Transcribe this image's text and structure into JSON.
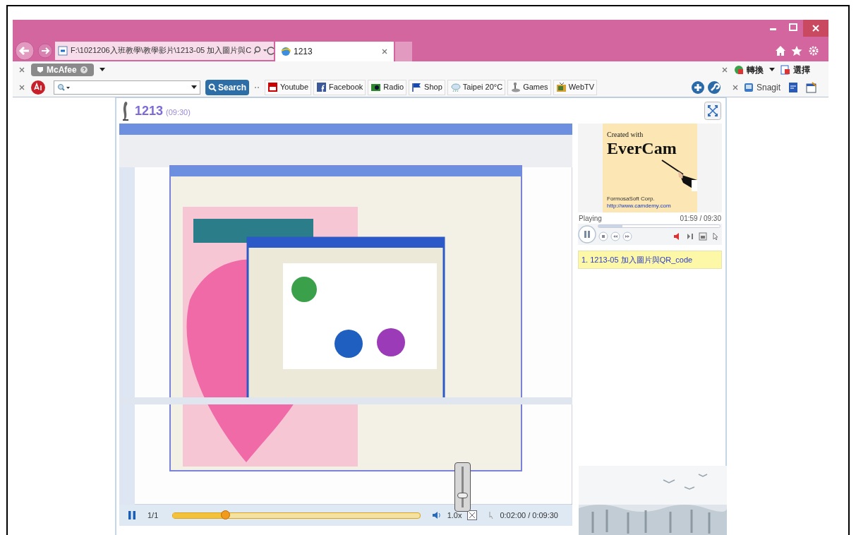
{
  "browser": {
    "address": "F:\\1021206入班教學\\教學影片\\1213-05 加入圖片與C",
    "tabs": [
      {
        "title": "1213",
        "selected": true
      }
    ]
  },
  "mcafee_bar": {
    "button": "McAfee",
    "right_items": [
      "轉換",
      "選擇"
    ]
  },
  "ask_bar": {
    "search_button": "Search",
    "links": [
      "Youtube",
      "Facebook",
      "Radio",
      "Shop",
      "Taipei 20°C",
      "Games",
      "WebTV"
    ],
    "snagit": "Snagit"
  },
  "player": {
    "title": "1213",
    "duration": "(09:30)",
    "controls": {
      "playing": true,
      "page": "1/1",
      "progress": {
        "level": 0.21
      },
      "speed": "1.0x",
      "time": "0:02:00 / 0:09:30",
      "volume": {
        "level": 0.3
      }
    }
  },
  "side_panel": {
    "logo": {
      "line_1": "Created with",
      "line_2": "EverCam",
      "line_3": "FormosaSoft Corp.",
      "line_4": "http://www.camdemy.com"
    },
    "status": "Playing",
    "time": "01:59 / 09:30",
    "progress": {
      "level": 0.2
    },
    "playing": true,
    "playlist": [
      {
        "label": "1. 1213-05 加入圖片與QR_code",
        "selected": true
      }
    ]
  }
}
